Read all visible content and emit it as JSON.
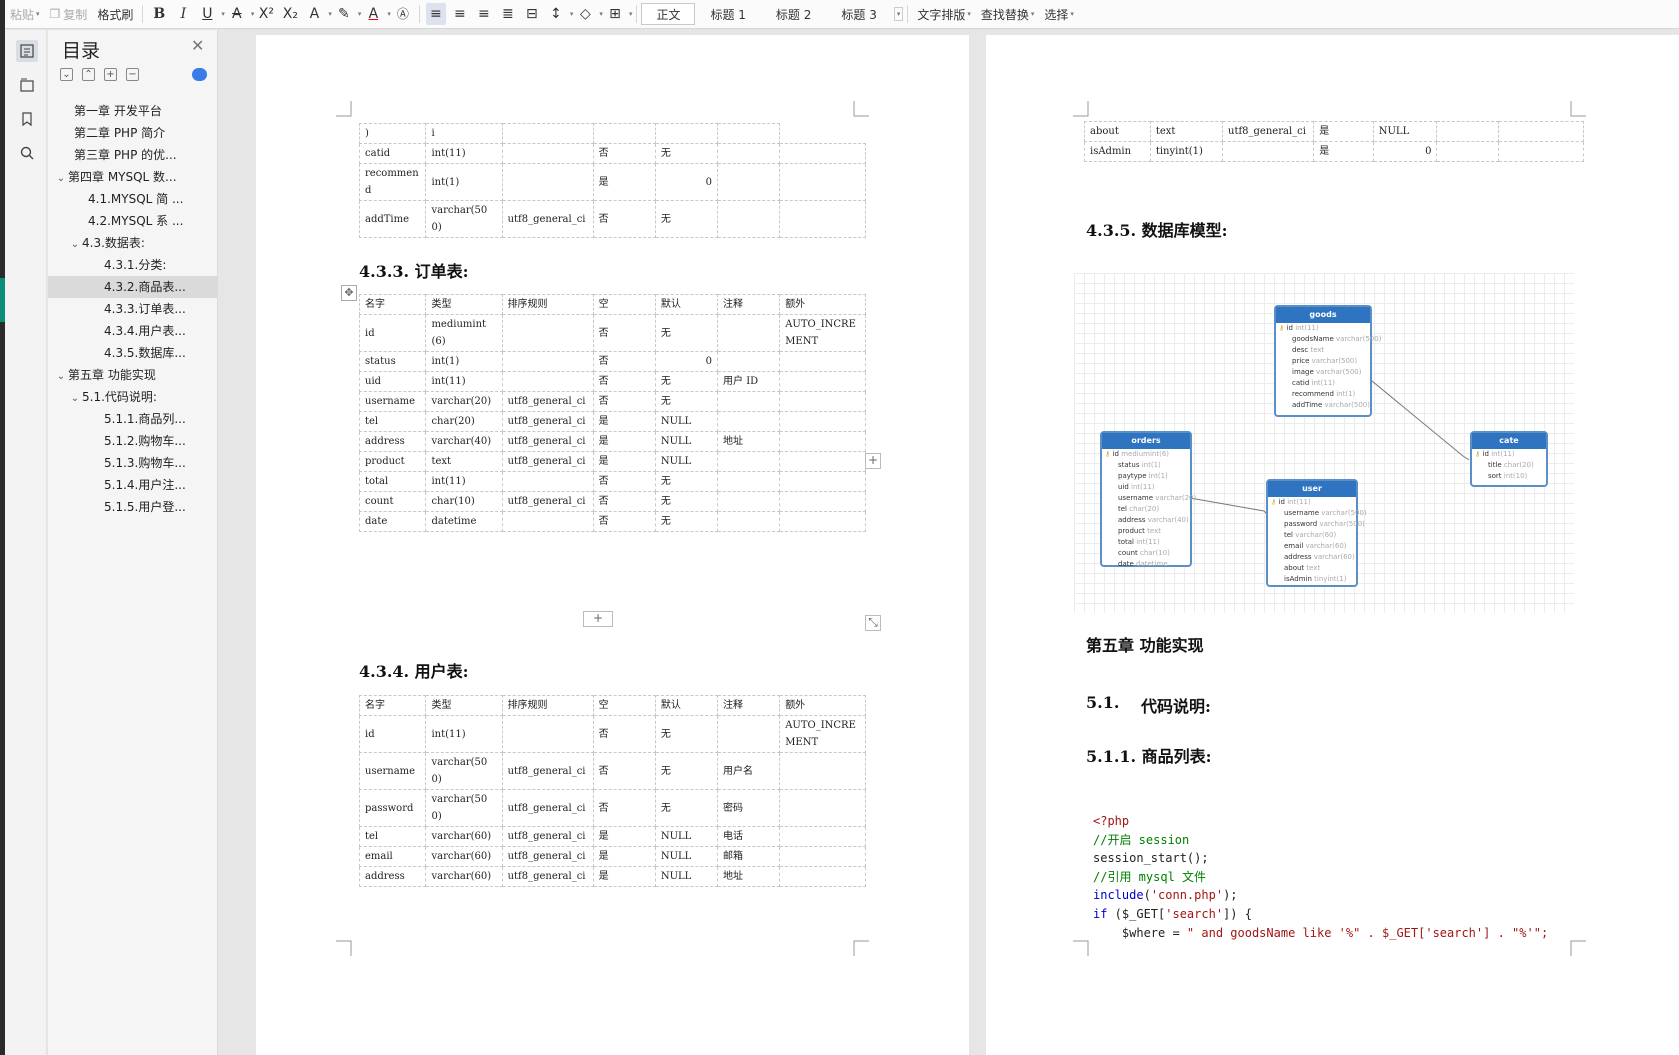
{
  "toolbar": {
    "paste": "粘贴",
    "copy": "复制",
    "format_painter": "格式刷",
    "style_normal": "正文",
    "style_h1": "标题 1",
    "style_h2": "标题 2",
    "style_h3": "标题 3",
    "text_layout": "文字排版",
    "find_replace": "查找替换",
    "select": "选择"
  },
  "nav": {
    "title": "目录",
    "items": [
      {
        "label": "第一章 开发平台",
        "level": 1
      },
      {
        "label": "第二章 PHP 简介",
        "level": 1
      },
      {
        "label": "第三章 PHP 的优...",
        "level": 1
      },
      {
        "label": "第四章 MYSQL 数...",
        "level": 1
      },
      {
        "label": "4.1.MYSQL 简 ...",
        "level": 2
      },
      {
        "label": "4.2.MYSQL 系 ...",
        "level": 2
      },
      {
        "label": "4.3.数据表:",
        "level": 2
      },
      {
        "label": "4.3.1.分类:",
        "level": 3
      },
      {
        "label": "4.3.2.商品表...",
        "level": 3
      },
      {
        "label": "4.3.3.订单表...",
        "level": 3
      },
      {
        "label": "4.3.4.用户表...",
        "level": 3
      },
      {
        "label": "4.3.5.数据库...",
        "level": 3
      },
      {
        "label": "第五章 功能实现",
        "level": 1
      },
      {
        "label": "5.1.代码说明:",
        "level": 2
      },
      {
        "label": "5.1.1.商品列...",
        "level": 3
      },
      {
        "label": "5.1.2.购物车...",
        "level": 3
      },
      {
        "label": "5.1.3.购物车...",
        "level": 3
      },
      {
        "label": "5.1.4.用户注...",
        "level": 3
      },
      {
        "label": "5.1.5.用户登...",
        "level": 3
      }
    ]
  },
  "goods_table_tail": {
    "rows": [
      [
        ")",
        "i",
        "",
        "",
        "",
        ""
      ],
      [
        "catid",
        "int(11)",
        "",
        "否",
        "无",
        "",
        ""
      ],
      [
        "recommend",
        "int(1)",
        "",
        "是",
        "0",
        "",
        ""
      ],
      [
        "addTime",
        "varchar(500)",
        "utf8_general_ci",
        "否",
        "无",
        "",
        ""
      ]
    ]
  },
  "orders": {
    "heading": "4.3.3. 订单表:",
    "columns": [
      "名字",
      "类型",
      "排序规则",
      "空",
      "默认",
      "注释",
      "额外"
    ],
    "rows": [
      [
        "id",
        "mediumint(6)",
        "",
        "否",
        "无",
        "",
        "AUTO_INCREMENT"
      ],
      [
        "status",
        "int(1)",
        "",
        "否",
        "0",
        "",
        ""
      ],
      [
        "uid",
        "int(11)",
        "",
        "否",
        "无",
        "用户 ID",
        ""
      ],
      [
        "username",
        "varchar(20)",
        "utf8_general_ci",
        "否",
        "无",
        "",
        ""
      ],
      [
        "tel",
        "char(20)",
        "utf8_general_ci",
        "是",
        "NULL",
        "",
        ""
      ],
      [
        "address",
        "varchar(40)",
        "utf8_general_ci",
        "是",
        "NULL",
        "地址",
        ""
      ],
      [
        "product",
        "text",
        "utf8_general_ci",
        "是",
        "NULL",
        "",
        ""
      ],
      [
        "total",
        "int(11)",
        "",
        "否",
        "无",
        "",
        ""
      ],
      [
        "count",
        "char(10)",
        "utf8_general_ci",
        "否",
        "无",
        "",
        ""
      ],
      [
        "date",
        "datetime",
        "",
        "否",
        "无",
        "",
        ""
      ]
    ]
  },
  "users": {
    "heading": "4.3.4. 用户表:",
    "columns": [
      "名字",
      "类型",
      "排序规则",
      "空",
      "默认",
      "注释",
      "额外"
    ],
    "rows": [
      [
        "id",
        "int(11)",
        "",
        "否",
        "无",
        "",
        "AUTO_INCREMENT"
      ],
      [
        "username",
        "varchar(500)",
        "utf8_general_ci",
        "否",
        "无",
        "用户名",
        ""
      ],
      [
        "password",
        "varchar(500)",
        "utf8_general_ci",
        "否",
        "无",
        "密码",
        ""
      ],
      [
        "tel",
        "varchar(60)",
        "utf8_general_ci",
        "是",
        "NULL",
        "电话",
        ""
      ],
      [
        "email",
        "varchar(60)",
        "utf8_general_ci",
        "是",
        "NULL",
        "邮箱",
        ""
      ],
      [
        "address",
        "varchar(60)",
        "utf8_general_ci",
        "是",
        "NULL",
        "地址",
        ""
      ]
    ]
  },
  "users_tail": {
    "rows": [
      [
        "about",
        "text",
        "utf8_general_ci",
        "是",
        "NULL",
        "",
        ""
      ],
      [
        "isAdmin",
        "tinyint(1)",
        "",
        "是",
        "0",
        "",
        ""
      ]
    ]
  },
  "model": {
    "heading": "4.3.5. 数据库模型:",
    "entities": {
      "goods": {
        "title": "goods",
        "fields": [
          [
            "id",
            "int(11)"
          ],
          [
            "goodsName",
            "varchar(500)"
          ],
          [
            "desc",
            "text"
          ],
          [
            "price",
            "varchar(500)"
          ],
          [
            "image",
            "varchar(500)"
          ],
          [
            "catid",
            "int(11)"
          ],
          [
            "recommend",
            "int(1)"
          ],
          [
            "addTime",
            "varchar(500)"
          ]
        ]
      },
      "cate": {
        "title": "cate",
        "fields": [
          [
            "id",
            "int(11)"
          ],
          [
            "title",
            "char(20)"
          ],
          [
            "sort",
            "int(10)"
          ]
        ]
      },
      "orders": {
        "title": "orders",
        "fields": [
          [
            "id",
            "mediumint(6)"
          ],
          [
            "status",
            "int(1)"
          ],
          [
            "paytype",
            "int(1)"
          ],
          [
            "uid",
            "int(11)"
          ],
          [
            "username",
            "varchar(20)"
          ],
          [
            "tel",
            "char(20)"
          ],
          [
            "address",
            "varchar(40)"
          ],
          [
            "product",
            "text"
          ],
          [
            "total",
            "int(11)"
          ],
          [
            "count",
            "char(10)"
          ],
          [
            "date",
            "datetime"
          ]
        ]
      },
      "user": {
        "title": "user",
        "fields": [
          [
            "id",
            "int(11)"
          ],
          [
            "username",
            "varchar(500)"
          ],
          [
            "password",
            "varchar(500)"
          ],
          [
            "tel",
            "varchar(60)"
          ],
          [
            "email",
            "varchar(60)"
          ],
          [
            "address",
            "varchar(60)"
          ],
          [
            "about",
            "text"
          ],
          [
            "isAdmin",
            "tinyint(1)"
          ]
        ]
      }
    }
  },
  "chapter5": {
    "title": "第五章  功能实现",
    "sec_num": "5.1.",
    "sec_title": "代码说明:",
    "sub": "5.1.1. 商品列表:"
  },
  "code": [
    "<?php",
    "//开启 session",
    "session_start();",
    "//引用 mysql 文件",
    "include('conn.php');",
    "if ($_GET['search']) {",
    "    $where = \" and goodsName like '%\" . $_GET['search'] . \"%'\";"
  ]
}
